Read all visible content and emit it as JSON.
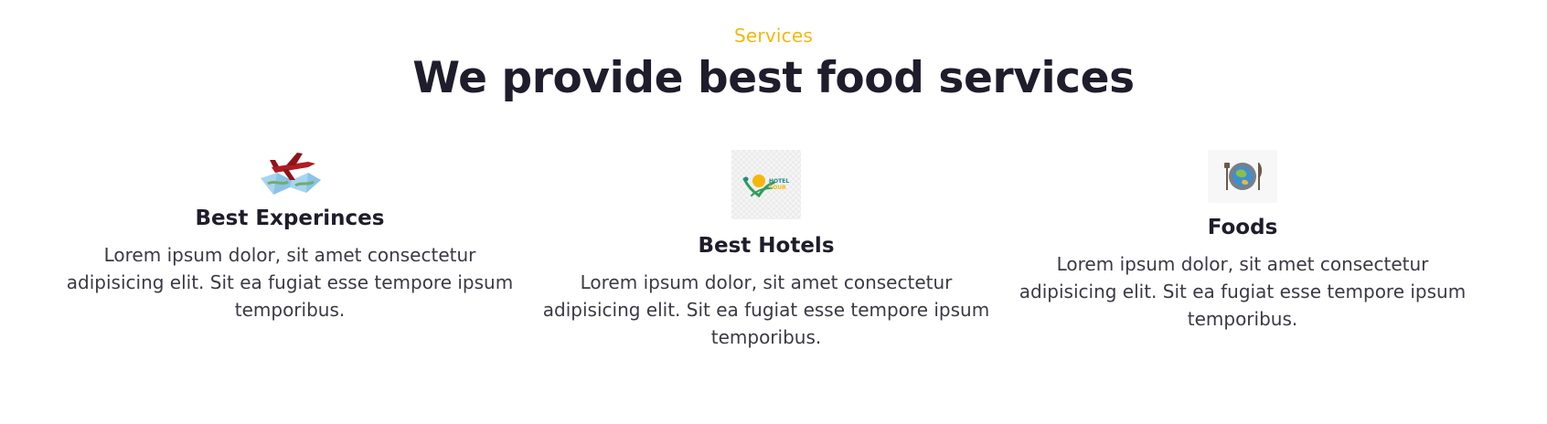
{
  "header": {
    "eyebrow": "Services",
    "title": "We provide best food services"
  },
  "cards": [
    {
      "icon": "airplane-map-image",
      "title": "Best Experinces",
      "text": "Lorem ipsum dolor, sit amet consectetur adipisicing elit. Sit ea fugiat esse tempore ipsum temporibus."
    },
    {
      "icon": "hotel-logo-image",
      "title": "Best Hotels",
      "text": "Lorem ipsum dolor, sit amet consectetur adipisicing elit. Sit ea fugiat esse tempore ipsum temporibus.",
      "logo_text_top": "HOTEL",
      "logo_text_bottom": "TOUR"
    },
    {
      "icon": "globe-plate-image",
      "title": "Foods",
      "text": "Lorem ipsum dolor, sit amet consectetur adipisicing elit. Sit ea fugiat esse tempore ipsum temporibus."
    }
  ],
  "colors": {
    "accent": "#f5b70a",
    "heading": "#1f1d2b",
    "body_text": "#3a3a44"
  }
}
